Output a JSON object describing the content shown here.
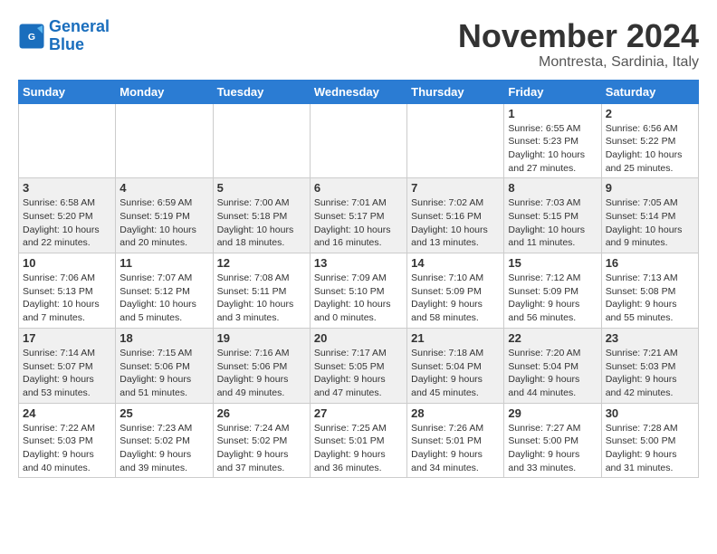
{
  "logo": {
    "line1": "General",
    "line2": "Blue"
  },
  "title": "November 2024",
  "subtitle": "Montresta, Sardinia, Italy",
  "weekdays": [
    "Sunday",
    "Monday",
    "Tuesday",
    "Wednesday",
    "Thursday",
    "Friday",
    "Saturday"
  ],
  "weeks": [
    [
      {
        "day": "",
        "info": ""
      },
      {
        "day": "",
        "info": ""
      },
      {
        "day": "",
        "info": ""
      },
      {
        "day": "",
        "info": ""
      },
      {
        "day": "",
        "info": ""
      },
      {
        "day": "1",
        "info": "Sunrise: 6:55 AM\nSunset: 5:23 PM\nDaylight: 10 hours\nand 27 minutes."
      },
      {
        "day": "2",
        "info": "Sunrise: 6:56 AM\nSunset: 5:22 PM\nDaylight: 10 hours\nand 25 minutes."
      }
    ],
    [
      {
        "day": "3",
        "info": "Sunrise: 6:58 AM\nSunset: 5:20 PM\nDaylight: 10 hours\nand 22 minutes."
      },
      {
        "day": "4",
        "info": "Sunrise: 6:59 AM\nSunset: 5:19 PM\nDaylight: 10 hours\nand 20 minutes."
      },
      {
        "day": "5",
        "info": "Sunrise: 7:00 AM\nSunset: 5:18 PM\nDaylight: 10 hours\nand 18 minutes."
      },
      {
        "day": "6",
        "info": "Sunrise: 7:01 AM\nSunset: 5:17 PM\nDaylight: 10 hours\nand 16 minutes."
      },
      {
        "day": "7",
        "info": "Sunrise: 7:02 AM\nSunset: 5:16 PM\nDaylight: 10 hours\nand 13 minutes."
      },
      {
        "day": "8",
        "info": "Sunrise: 7:03 AM\nSunset: 5:15 PM\nDaylight: 10 hours\nand 11 minutes."
      },
      {
        "day": "9",
        "info": "Sunrise: 7:05 AM\nSunset: 5:14 PM\nDaylight: 10 hours\nand 9 minutes."
      }
    ],
    [
      {
        "day": "10",
        "info": "Sunrise: 7:06 AM\nSunset: 5:13 PM\nDaylight: 10 hours\nand 7 minutes."
      },
      {
        "day": "11",
        "info": "Sunrise: 7:07 AM\nSunset: 5:12 PM\nDaylight: 10 hours\nand 5 minutes."
      },
      {
        "day": "12",
        "info": "Sunrise: 7:08 AM\nSunset: 5:11 PM\nDaylight: 10 hours\nand 3 minutes."
      },
      {
        "day": "13",
        "info": "Sunrise: 7:09 AM\nSunset: 5:10 PM\nDaylight: 10 hours\nand 0 minutes."
      },
      {
        "day": "14",
        "info": "Sunrise: 7:10 AM\nSunset: 5:09 PM\nDaylight: 9 hours\nand 58 minutes."
      },
      {
        "day": "15",
        "info": "Sunrise: 7:12 AM\nSunset: 5:09 PM\nDaylight: 9 hours\nand 56 minutes."
      },
      {
        "day": "16",
        "info": "Sunrise: 7:13 AM\nSunset: 5:08 PM\nDaylight: 9 hours\nand 55 minutes."
      }
    ],
    [
      {
        "day": "17",
        "info": "Sunrise: 7:14 AM\nSunset: 5:07 PM\nDaylight: 9 hours\nand 53 minutes."
      },
      {
        "day": "18",
        "info": "Sunrise: 7:15 AM\nSunset: 5:06 PM\nDaylight: 9 hours\nand 51 minutes."
      },
      {
        "day": "19",
        "info": "Sunrise: 7:16 AM\nSunset: 5:06 PM\nDaylight: 9 hours\nand 49 minutes."
      },
      {
        "day": "20",
        "info": "Sunrise: 7:17 AM\nSunset: 5:05 PM\nDaylight: 9 hours\nand 47 minutes."
      },
      {
        "day": "21",
        "info": "Sunrise: 7:18 AM\nSunset: 5:04 PM\nDaylight: 9 hours\nand 45 minutes."
      },
      {
        "day": "22",
        "info": "Sunrise: 7:20 AM\nSunset: 5:04 PM\nDaylight: 9 hours\nand 44 minutes."
      },
      {
        "day": "23",
        "info": "Sunrise: 7:21 AM\nSunset: 5:03 PM\nDaylight: 9 hours\nand 42 minutes."
      }
    ],
    [
      {
        "day": "24",
        "info": "Sunrise: 7:22 AM\nSunset: 5:03 PM\nDaylight: 9 hours\nand 40 minutes."
      },
      {
        "day": "25",
        "info": "Sunrise: 7:23 AM\nSunset: 5:02 PM\nDaylight: 9 hours\nand 39 minutes."
      },
      {
        "day": "26",
        "info": "Sunrise: 7:24 AM\nSunset: 5:02 PM\nDaylight: 9 hours\nand 37 minutes."
      },
      {
        "day": "27",
        "info": "Sunrise: 7:25 AM\nSunset: 5:01 PM\nDaylight: 9 hours\nand 36 minutes."
      },
      {
        "day": "28",
        "info": "Sunrise: 7:26 AM\nSunset: 5:01 PM\nDaylight: 9 hours\nand 34 minutes."
      },
      {
        "day": "29",
        "info": "Sunrise: 7:27 AM\nSunset: 5:00 PM\nDaylight: 9 hours\nand 33 minutes."
      },
      {
        "day": "30",
        "info": "Sunrise: 7:28 AM\nSunset: 5:00 PM\nDaylight: 9 hours\nand 31 minutes."
      }
    ]
  ]
}
